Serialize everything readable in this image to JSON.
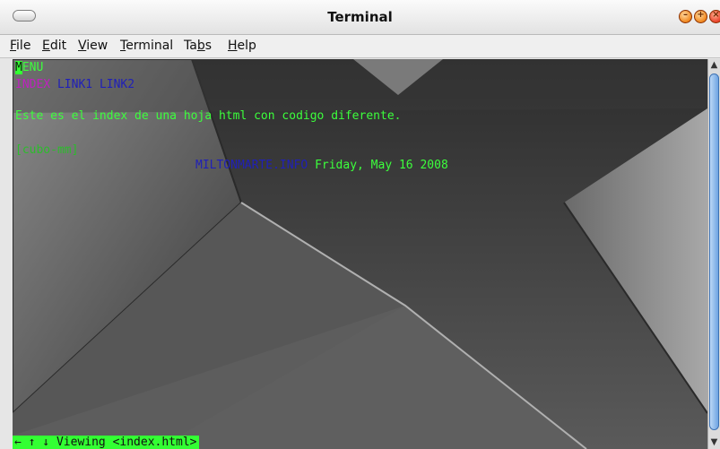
{
  "window": {
    "title": "Terminal"
  },
  "menubar": {
    "items": [
      {
        "label": "File",
        "mnemonic_index": 0
      },
      {
        "label": "Edit",
        "mnemonic_index": 0
      },
      {
        "label": "View",
        "mnemonic_index": 0
      },
      {
        "label": "Terminal",
        "mnemonic_index": 0
      },
      {
        "label": "Tabs",
        "mnemonic_index": 2
      },
      {
        "label": "Help",
        "mnemonic_index": 0
      }
    ]
  },
  "terminal": {
    "line1": {
      "cursor_char": "M",
      "rest": "ENU"
    },
    "line2": {
      "index": "INDEX",
      "link1": "LINK1",
      "link2": "LINK2"
    },
    "line3": "Este es el index de una hoja html con codigo diferente.",
    "line4": "[cubo-mm]",
    "line5": {
      "site": "MILTONMARTE.INFO",
      "date": "Friday, May 16 2008"
    },
    "status": "← ↑ ↓ Viewing <index.html>"
  },
  "colors": {
    "terminal_green": "#3cff3c",
    "link_blue": "#2020b8",
    "index_magenta": "#c020c0"
  },
  "icons": {
    "window_menu": "window-menu-icon",
    "minimize": "minimize-icon",
    "maximize": "maximize-icon",
    "close": "close-icon"
  }
}
